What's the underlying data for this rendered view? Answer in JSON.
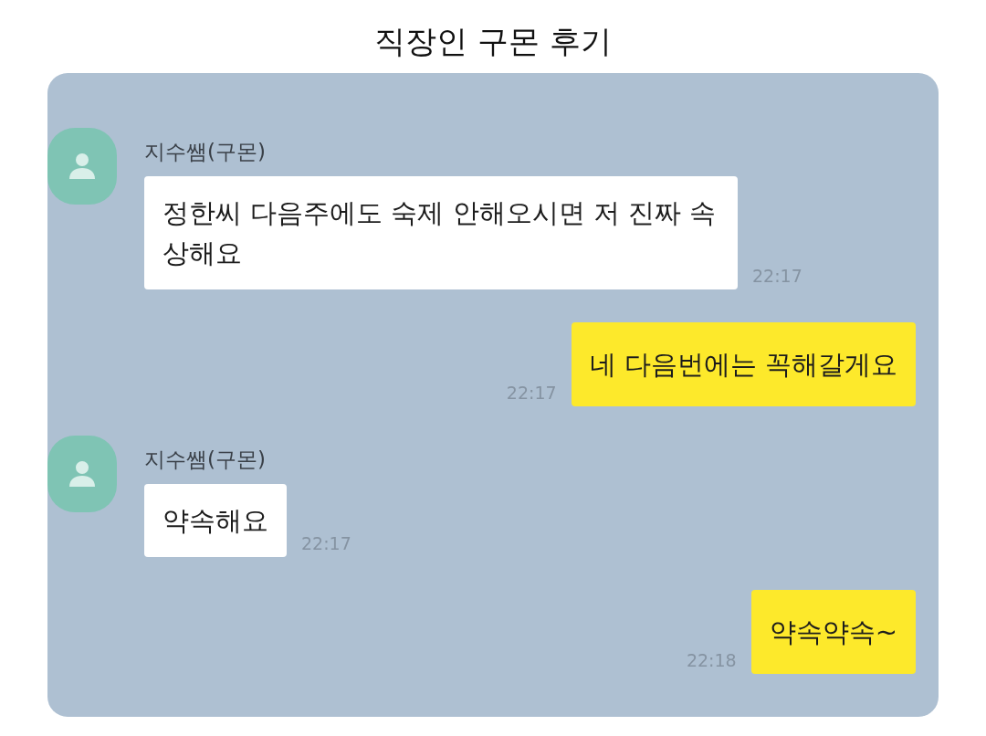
{
  "title": "직장인 구몬 후기",
  "messages": [
    {
      "kind": "received",
      "sender": "지수쌤(구몬)",
      "text": "정한씨 다음주에도 숙제 안해오시면 저 진짜 속상해요",
      "time": "22:17"
    },
    {
      "kind": "sent",
      "text": "네 다음번에는 꼭해갈게요",
      "time": "22:17"
    },
    {
      "kind": "received",
      "sender": "지수쌤(구몬)",
      "text": "약속해요",
      "time": "22:17"
    },
    {
      "kind": "sent",
      "text": "약속약속~",
      "time": "22:18"
    }
  ]
}
